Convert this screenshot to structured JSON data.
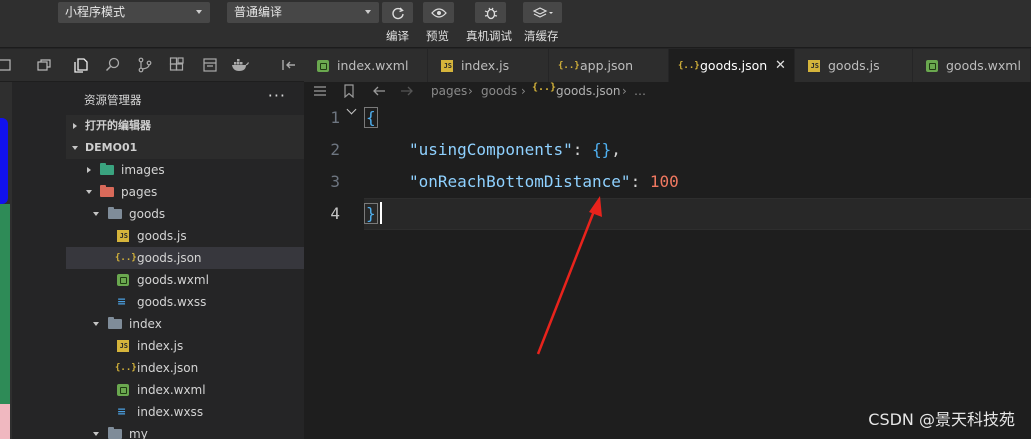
{
  "toolbar": {
    "mode_select": "小程序模式",
    "compile_select": "普通编译",
    "compile_label": "编译",
    "preview_label": "预览",
    "debug_label": "真机调试",
    "cache_label": "清缓存"
  },
  "explorer": {
    "title": "资源管理器",
    "more": "···",
    "sections": {
      "open_editors": "打开的编辑器",
      "project": "DEMO01"
    },
    "tree": {
      "images": "images",
      "pages": "pages",
      "goods": "goods",
      "goods_js": "goods.js",
      "goods_json": "goods.json",
      "goods_wxml": "goods.wxml",
      "goods_wxss": "goods.wxss",
      "index": "index",
      "index_js": "index.js",
      "index_json": "index.json",
      "index_wxml": "index.wxml",
      "index_wxss": "index.wxss",
      "my": "my"
    }
  },
  "tabs": [
    {
      "label": "index.wxml",
      "type": "wxml"
    },
    {
      "label": "index.js",
      "type": "js"
    },
    {
      "label": "app.json",
      "type": "json"
    },
    {
      "label": "goods.json",
      "type": "json",
      "active": true
    },
    {
      "label": "goods.js",
      "type": "js"
    },
    {
      "label": "goods.wxml",
      "type": "wxml"
    }
  ],
  "tab_close": "✕",
  "breadcrumb": {
    "pages": "pages",
    "goods": "goods",
    "file": "goods.json",
    "more": "…"
  },
  "editor": {
    "line_numbers": [
      "1",
      "2",
      "3",
      "4"
    ],
    "open_brace": "{",
    "key1": "\"usingComponents\"",
    "colon1": ": ",
    "val1": "{}",
    "comma1": ",",
    "key2": "\"onReachBottomDistance\"",
    "colon2": ": ",
    "val2": "100",
    "close_brace": "}"
  },
  "watermark": "CSDN @景天科技苑",
  "colors": {
    "annotation_arrow": "#e8231c",
    "editor_bg": "#1e1e1e",
    "string": "#8fd1ff",
    "number": "#f07860"
  }
}
